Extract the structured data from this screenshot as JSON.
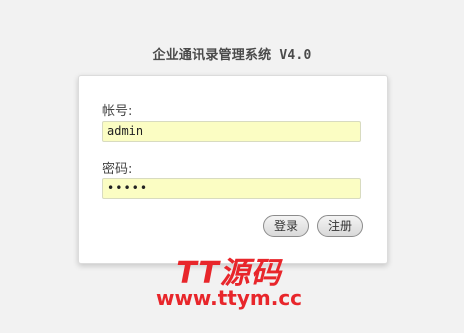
{
  "app": {
    "title": "企业通讯录管理系统 V4.0"
  },
  "login_form": {
    "username_label": "帐号:",
    "username_value": "admin",
    "password_label": "密码:",
    "password_value": "•••••",
    "login_button": "登录",
    "register_button": "注册"
  },
  "watermark": {
    "logo_text": "TT源码",
    "url": "www.ttym.cc"
  },
  "colors": {
    "page_background": "#f2f2f2",
    "input_background": "#fbfdc3",
    "watermark": "#e8262b"
  }
}
